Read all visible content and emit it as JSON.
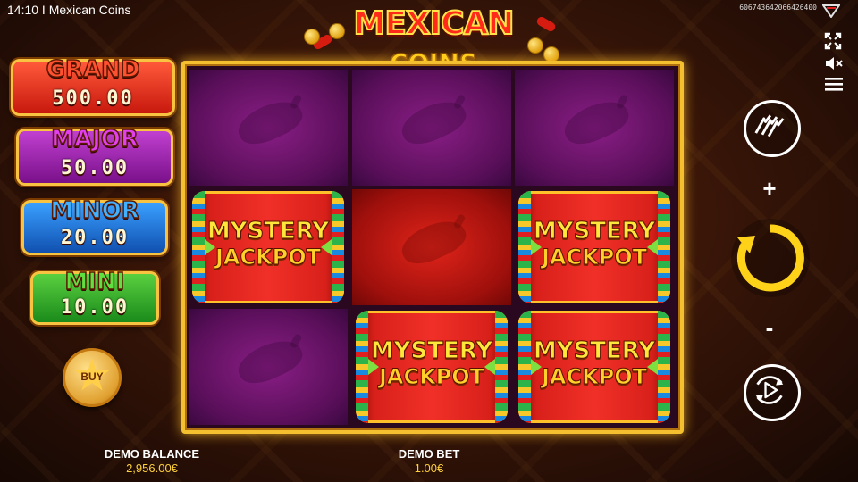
{
  "window": {
    "title": "14:10 I Mexican Coins"
  },
  "session_id": "606743642066426400",
  "logo": {
    "line1": "MEXICAN",
    "line2": "COINS"
  },
  "jackpots": [
    {
      "label": "GRAND",
      "value": "500.00",
      "color": "#c8180e"
    },
    {
      "label": "MAJOR",
      "value": "50.00",
      "color": "#7a108a"
    },
    {
      "label": "MINOR",
      "value": "20.00",
      "color": "#1050b0"
    },
    {
      "label": "MINI",
      "value": "10.00",
      "color": "#1a8a1a"
    }
  ],
  "buy_button": {
    "label": "BUY"
  },
  "reels": {
    "rows": 3,
    "cols": 3,
    "cells": [
      {
        "symbol": "purple-chili"
      },
      {
        "symbol": "purple-chili"
      },
      {
        "symbol": "purple-chili"
      },
      {
        "symbol": "mystery-jackpot"
      },
      {
        "symbol": "red-chili"
      },
      {
        "symbol": "mystery-jackpot"
      },
      {
        "symbol": "purple-chili"
      },
      {
        "symbol": "mystery-jackpot"
      },
      {
        "symbol": "mystery-jackpot"
      }
    ],
    "mystery_line1": "MYSTERY",
    "mystery_line2": "JACKPOT"
  },
  "controls": {
    "plus": "+",
    "minus": "-",
    "icons": [
      "fullscreen-icon",
      "sound-muted-icon",
      "menu-icon",
      "turbo-icon",
      "spin-icon",
      "autoplay-icon"
    ]
  },
  "footer": {
    "balance_label": "DEMO BALANCE",
    "balance_value": "2,956.00€",
    "bet_label": "DEMO BET",
    "bet_value": "1.00€"
  },
  "colors": {
    "frame": "#f5c030",
    "spin": "#ffd21a",
    "accent_text": "#ffd23a"
  }
}
